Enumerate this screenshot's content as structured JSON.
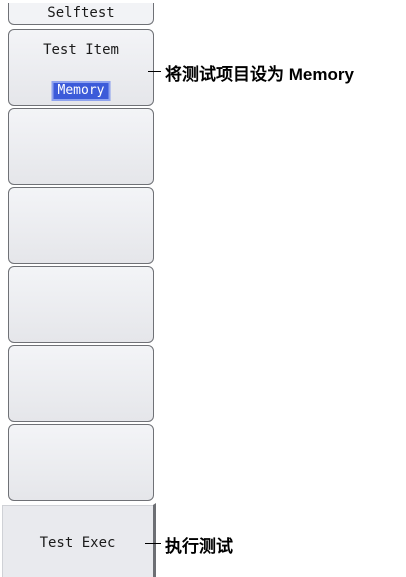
{
  "menu": {
    "title": "Selftest",
    "test_item": {
      "label": "Test Item",
      "value": "Memory"
    },
    "empty_keys": [
      {
        "label": ""
      },
      {
        "label": ""
      },
      {
        "label": ""
      },
      {
        "label": ""
      },
      {
        "label": ""
      }
    ],
    "exec": {
      "label": "Test Exec"
    }
  },
  "annotations": {
    "test_item": "将测试项目设为 Memory",
    "exec": "执行测试"
  }
}
